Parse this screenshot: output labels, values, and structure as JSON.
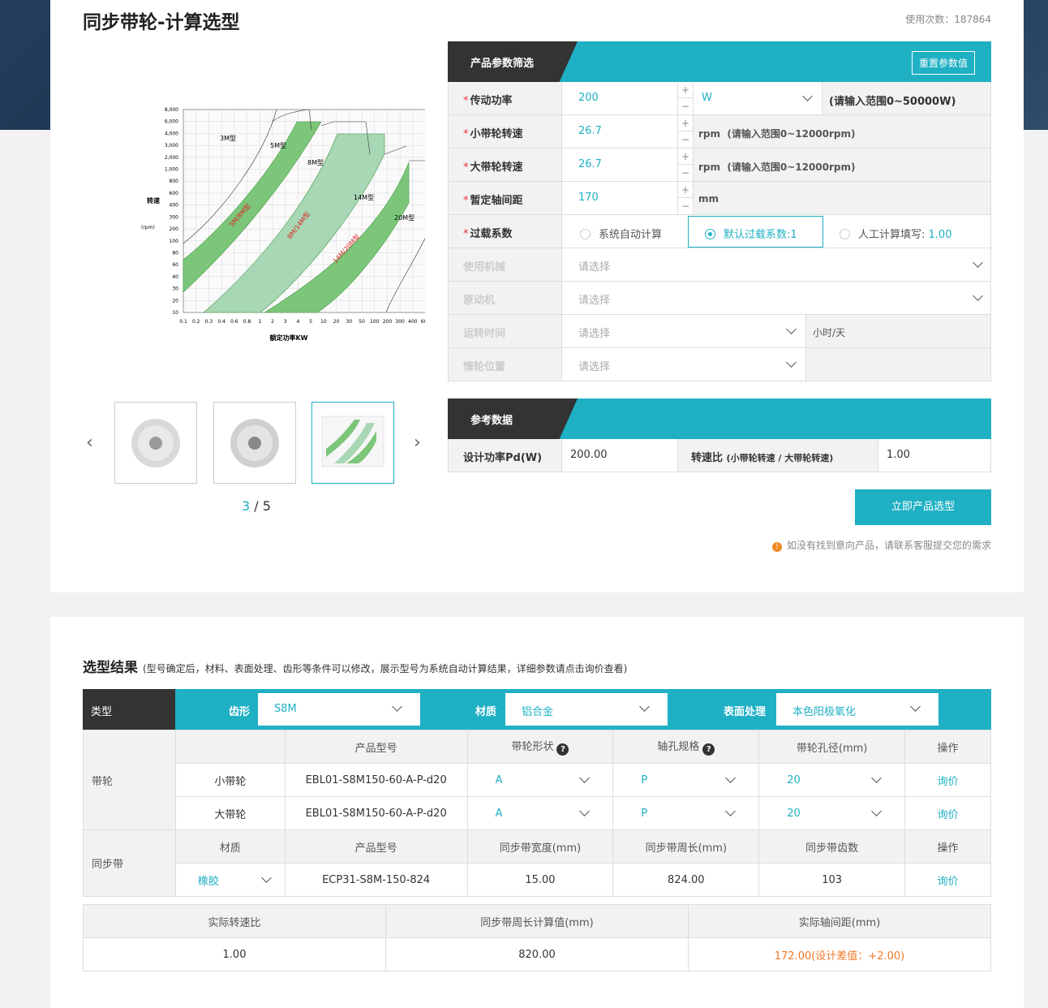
{
  "header": {
    "title": "同步带轮-计算选型",
    "usage": "使用次数：187864"
  },
  "chart_data": {
    "type": "area",
    "title": "",
    "xlabel": "额定功率KW",
    "ylabel": "转速",
    "yunit": "(rpm)",
    "xticks": [
      "0.1",
      "0.2",
      "0.3",
      "0.4",
      "0.6",
      "0.8",
      "1",
      "2",
      "3",
      "4",
      "5",
      "10",
      "20",
      "30",
      "50",
      "100",
      "200",
      "300",
      "400",
      "600",
      "800",
      "1000"
    ],
    "yticks": [
      "10",
      "20",
      "30",
      "40",
      "60",
      "80",
      "100",
      "200",
      "300",
      "400",
      "600",
      "800",
      "1,000",
      "2,000",
      "3,000",
      "4,000",
      "6,000",
      "8,000"
    ],
    "regions": [
      "3M型",
      "5M型",
      "8M型",
      "14M型",
      "20M型"
    ],
    "bands": [
      "5M/8M型",
      "8M/14M型",
      "14M/20M型"
    ]
  },
  "gallery": {
    "current": "3",
    "sep": " / ",
    "total": "5",
    "prev": "‹",
    "next": "›"
  },
  "filter": {
    "title": "产品参数筛选",
    "reset": "重置参数值",
    "power": {
      "label": "传动功率",
      "value": "200",
      "unit": "W",
      "hint": "(请输入范围0~50000W)"
    },
    "small_speed": {
      "label": "小带轮转速",
      "value": "26.7",
      "hint": "rpm  (请输入范围0~12000rpm)"
    },
    "large_speed": {
      "label": "大带轮转速",
      "value": "26.7",
      "hint": "rpm  (请输入范围0~12000rpm)"
    },
    "center": {
      "label": "暂定轴间距",
      "value": "170",
      "unit": "mm"
    },
    "overload": {
      "label": "过载系数",
      "opt1": "系统自动计算",
      "opt2": "默认过载系数:1",
      "opt3": "人工计算填写:",
      "opt3_val": "1.00"
    },
    "machine": {
      "label": "使用机械",
      "placeholder": "请选择"
    },
    "driver": {
      "label": "原动机",
      "placeholder": "请选择"
    },
    "runtime": {
      "label": "运转时间",
      "placeholder": "请选择",
      "unit": "小时/天"
    },
    "idler": {
      "label": "惰轮位置",
      "placeholder": "请选择"
    },
    "plus": "+",
    "minus": "−",
    "req": "*"
  },
  "reference": {
    "title": "参考数据",
    "pd_label": "设计功率Pd(W)",
    "pd_value": "200.00",
    "ratio_label": "转速比",
    "ratio_sub": "(小带轮转速 / 大带轮转速)",
    "ratio_value": "1.00"
  },
  "action": {
    "button": "立即产品选型",
    "note": "如没有找到意向产品，请联系客服提交您的需求",
    "note_icon": "!"
  },
  "result": {
    "title": "选型结果",
    "subtitle": "(型号确定后，材料、表面处理、齿形等条件可以修改，展示型号为系统自动计算结果，详细参数请点击询价查看)",
    "type_label": "类型",
    "tooth_label": "齿形",
    "tooth_value": "S8M",
    "material_label": "材质",
    "material_value": "铝合金",
    "surface_label": "表面处理",
    "surface_value": "本色阳极氧化",
    "pulley": {
      "group": "带轮",
      "headers": [
        "产品型号",
        "带轮形状",
        "轴孔规格",
        "带轮孔径(mm)",
        "操作"
      ],
      "rows": [
        {
          "name": "小带轮",
          "model": "EBL01-S8M150-60-A-P-d20",
          "shape": "A",
          "bore": "P",
          "dia": "20",
          "op": "询价"
        },
        {
          "name": "大带轮",
          "model": "EBL01-S8M150-60-A-P-d20",
          "shape": "A",
          "bore": "P",
          "dia": "20",
          "op": "询价"
        }
      ]
    },
    "belt": {
      "group": "同步带",
      "headers": [
        "材质",
        "产品型号",
        "同步带宽度(mm)",
        "同步带周长(mm)",
        "同步带齿数",
        "操作"
      ],
      "row": {
        "material": "橡胶",
        "model": "ECP31-S8M-150-824",
        "width": "15.00",
        "length": "824.00",
        "teeth": "103",
        "op": "询价"
      }
    },
    "summary": {
      "headers": [
        "实际转速比",
        "同步带周长计算值(mm)",
        "实际轴间距(mm)"
      ],
      "values": [
        "1.00",
        "820.00",
        "172.00(设计差值：+2.00)"
      ]
    },
    "q": "?"
  },
  "colors": {
    "accent": "#1fb0c4",
    "dark": "#333333",
    "warn": "#f07a24"
  }
}
